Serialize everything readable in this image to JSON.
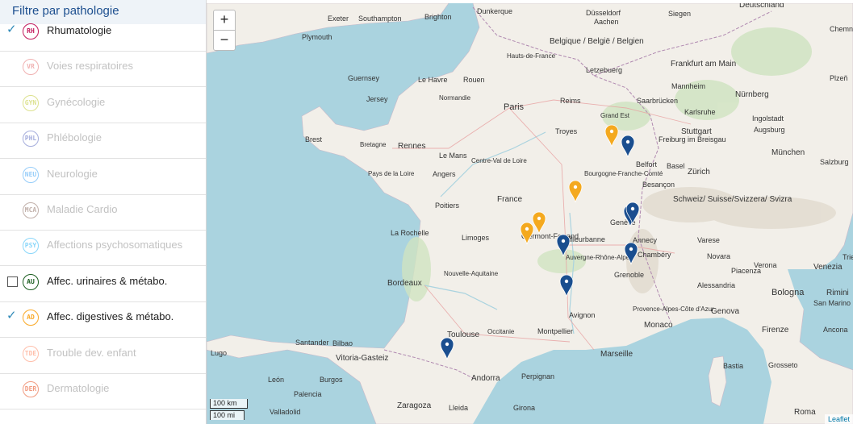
{
  "panel": {
    "title": "Filtre par pathologie",
    "items": [
      {
        "code": "RH",
        "label": "Rhumatologie",
        "state": "checked",
        "color": "#c2185b",
        "enabled": true
      },
      {
        "code": "VR",
        "label": "Voies respiratoires",
        "state": "none",
        "color": "#e57373",
        "enabled": false
      },
      {
        "code": "GYN",
        "label": "Gynécologie",
        "state": "none",
        "color": "#c0ca33",
        "enabled": false
      },
      {
        "code": "PHL",
        "label": "Phlébologie",
        "state": "none",
        "color": "#5c6bc0",
        "enabled": false
      },
      {
        "code": "NEU",
        "label": "Neurologie",
        "state": "none",
        "color": "#42a5f5",
        "enabled": false
      },
      {
        "code": "MCA",
        "label": "Maladie Cardio",
        "state": "none",
        "color": "#8d6e63",
        "enabled": false
      },
      {
        "code": "PSY",
        "label": "Affections psychosomatiques",
        "state": "none",
        "color": "#29b6f6",
        "enabled": false
      },
      {
        "code": "AU",
        "label": "Affec. urinaires & métabo.",
        "state": "unchecked",
        "color": "#1b5e20",
        "enabled": true
      },
      {
        "code": "AD",
        "label": "Affec. digestives & métabo.",
        "state": "checked",
        "color": "#f9a825",
        "enabled": true
      },
      {
        "code": "TDE",
        "label": "Trouble dev. enfant",
        "state": "none",
        "color": "#ff8a65",
        "enabled": false
      },
      {
        "code": "DER",
        "label": "Dermatologie",
        "state": "none",
        "color": "#e64a19",
        "enabled": false
      }
    ]
  },
  "map": {
    "zoom_in": "+",
    "zoom_out": "−",
    "scale_km": "100 km",
    "scale_mi": "100 mi",
    "attribution": "Leaflet",
    "colors": {
      "sea": "#aad3df",
      "land": "#f2efe9",
      "pin_blue": "#1a4e8f",
      "pin_orange": "#f4a91f"
    },
    "labels": [
      "Exeter",
      "Southampton",
      "Brighton",
      "Dunkerque",
      "Düsseldorf",
      "Deutschland",
      "Plymouth",
      "Siegen",
      "Aachen",
      "Chemnitz",
      "Belgique / België / Belgien",
      "Guernsey",
      "Jersey",
      "Le Havre",
      "Rouen",
      "Frankfurt am Main",
      "Letzebuerg",
      "Mannheim",
      "Nürnberg",
      "Plzeň",
      "Paris",
      "Reims",
      "Saarbrücken",
      "Karlsruhe",
      "Ingolstadt",
      "Brest",
      "Rennes",
      "Troyes",
      "Grand Est",
      "Stuttgart",
      "Augsburg",
      "Le Mans",
      "Freiburg im Breisgau",
      "München",
      "Angers",
      "Belfort",
      "Basel",
      "Zürich",
      "Salzburg",
      "Bourgogne-Franche-Comté",
      "Besançon",
      "Schweiz/ Suisse/Svizzera/ Svizra",
      "France",
      "Poitiers",
      "Genève",
      "La Rochelle",
      "Limoges",
      "Villeurbanne",
      "Annecy",
      "Clermont-Ferrand",
      "Chambéry",
      "Varese",
      "Verona",
      "Venezia",
      "Trieste",
      "Novara",
      "Piacenza",
      "Grenoble",
      "Bordeaux",
      "Auvergne-Rhône-Alpes",
      "Alessandria",
      "Bologna",
      "Avignon",
      "Genova",
      "Rimini",
      "San Marino",
      "Toulouse",
      "Montpellier",
      "Monaco",
      "Occitanie",
      "Provence-Alpes-Côte d'Azur",
      "Firenze",
      "Ancona",
      "Lugo",
      "Santander",
      "Bilbao",
      "Vitoria-Gasteiz",
      "Marseille",
      "Bastia",
      "Grosseto",
      "León",
      "Burgos",
      "Andorra",
      "Perpignan",
      "Palencia",
      "Zaragoza",
      "Lleida",
      "Girona",
      "Roma",
      "Valladolid",
      "Normandie",
      "Bretagne",
      "Centre-Val de Loire",
      "Pays de la Loire",
      "Hauts-de-France",
      "Nouvelle-Aquitaine"
    ],
    "pins": [
      {
        "color": "blue"
      },
      {
        "color": "orange"
      },
      {
        "color": "orange"
      },
      {
        "color": "blue"
      },
      {
        "color": "blue"
      },
      {
        "color": "orange"
      },
      {
        "color": "orange"
      },
      {
        "color": "blue"
      },
      {
        "color": "blue"
      },
      {
        "color": "blue"
      },
      {
        "color": "blue"
      }
    ]
  }
}
